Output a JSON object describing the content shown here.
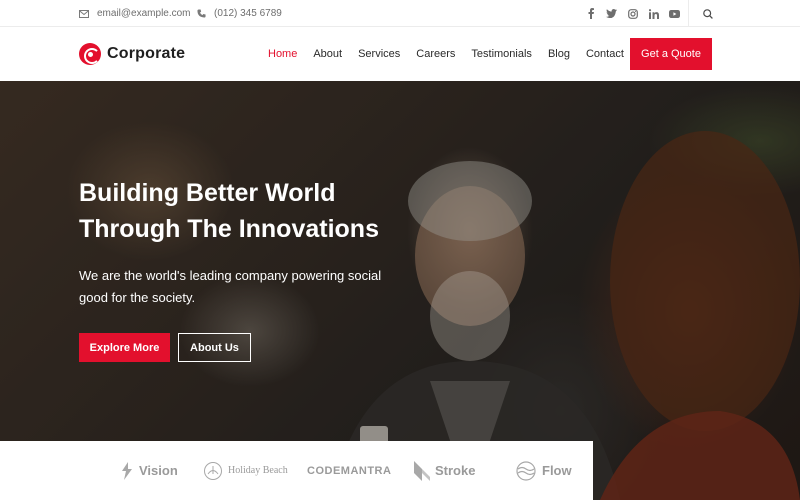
{
  "topbar": {
    "email": "email@example.com",
    "phone": "(012) 345 6789",
    "email_icon": "envelope-icon",
    "phone_icon": "phone-icon",
    "socials": [
      "facebook-icon",
      "twitter-icon",
      "instagram-icon",
      "linkedin-icon",
      "youtube-icon"
    ],
    "search_icon": "search-icon"
  },
  "header": {
    "logo_text": "Corporate",
    "nav": [
      "Home",
      "About",
      "Services",
      "Careers",
      "Testimonials",
      "Blog",
      "Contact"
    ],
    "active_nav": "Home",
    "cta": "Get a Quote"
  },
  "hero": {
    "title_line1": "Building Better World",
    "title_line2": "Through The Innovations",
    "subtitle": "We are the world's leading company powering social good for the society.",
    "primary_button": "Explore More",
    "secondary_button": "About Us"
  },
  "brands": [
    "Vision",
    "Holiday Beach",
    "CODEMANTRA",
    "Stroke",
    "Flow"
  ],
  "colors": {
    "accent": "#e3102d",
    "text": "#1f1f1f",
    "muted": "#6e6e6e",
    "brand_gray": "#9a9a9a"
  }
}
